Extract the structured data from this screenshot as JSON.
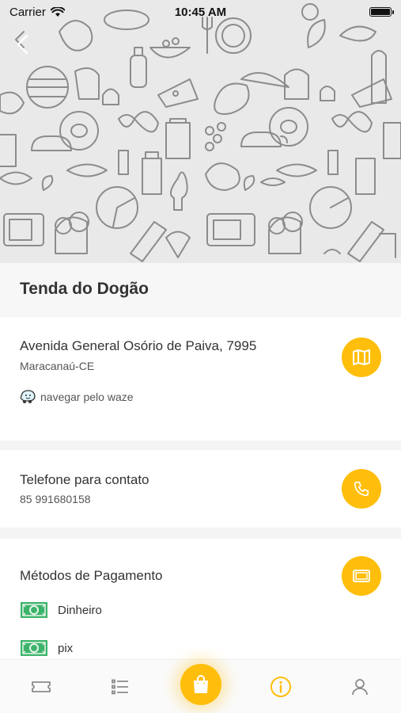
{
  "status_bar": {
    "carrier": "Carrier",
    "time": "10:45 AM"
  },
  "store": {
    "name": "Tenda do Dogão"
  },
  "address": {
    "street": "Avenida General Osório de Paiva, 7995",
    "city": "Maracanaú-CE",
    "waze_label": "navegar pelo waze"
  },
  "phone": {
    "label": "Telefone para contato",
    "number": "85 991680158"
  },
  "payment": {
    "title": "Métodos de Pagamento",
    "methods": [
      {
        "label": "Dinheiro"
      },
      {
        "label": "pix"
      }
    ]
  },
  "tabs": [
    {
      "icon": "ticket-icon"
    },
    {
      "icon": "list-icon"
    },
    {
      "icon": "shopping-bag-icon"
    },
    {
      "icon": "info-icon"
    },
    {
      "icon": "user-icon"
    }
  ],
  "colors": {
    "accent": "#FFBE0B",
    "inactive_icon": "#8a8a8a",
    "money_green": "#3cb36a"
  }
}
